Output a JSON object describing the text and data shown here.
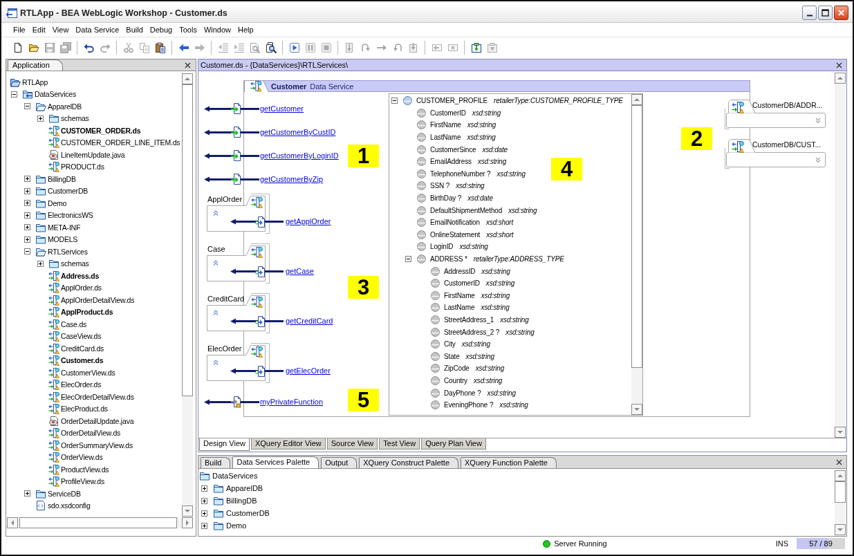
{
  "window": {
    "title": "RTLApp - BEA WebLogic Workshop - Customer.ds"
  },
  "menu": [
    "File",
    "Edit",
    "View",
    "Data Service",
    "Build",
    "Debug",
    "Tools",
    "Window",
    "Help"
  ],
  "toolbar": [
    [
      {
        "kind": "new",
        "disabled": false
      },
      {
        "kind": "open",
        "disabled": false
      },
      {
        "kind": "save",
        "disabled": true
      },
      {
        "kind": "saveall",
        "disabled": true
      }
    ],
    [
      {
        "kind": "undo",
        "disabled": false
      },
      {
        "kind": "redo",
        "disabled": true
      }
    ],
    [
      {
        "kind": "cut",
        "disabled": true
      },
      {
        "kind": "copy",
        "disabled": true
      },
      {
        "kind": "paste",
        "disabled": false
      }
    ],
    [
      {
        "kind": "back",
        "disabled": false
      },
      {
        "kind": "forward",
        "disabled": true
      }
    ],
    [
      {
        "kind": "outdent",
        "disabled": true
      },
      {
        "kind": "indent",
        "disabled": true
      },
      {
        "kind": "find",
        "disabled": true
      },
      {
        "kind": "findfiles",
        "disabled": false
      }
    ],
    [
      {
        "kind": "run",
        "disabled": false
      },
      {
        "kind": "pause",
        "disabled": true
      },
      {
        "kind": "stop",
        "disabled": true
      }
    ],
    [
      {
        "kind": "stepinto",
        "disabled": true
      },
      {
        "kind": "stepover",
        "disabled": true
      },
      {
        "kind": "stepnext",
        "disabled": true
      },
      {
        "kind": "stepout",
        "disabled": true
      },
      {
        "kind": "runto",
        "disabled": true
      }
    ],
    [
      {
        "kind": "collapse",
        "disabled": true
      },
      {
        "kind": "expand",
        "disabled": true
      }
    ],
    [
      {
        "kind": "import",
        "disabled": false
      },
      {
        "kind": "remove",
        "disabled": true
      }
    ]
  ],
  "app_panel": {
    "tab": "Application",
    "tree": [
      {
        "label": "RTLApp",
        "kind": "project",
        "children": [
          {
            "label": "DataServices",
            "kind": "services",
            "expanded": true,
            "children": [
              {
                "label": "ApparelDB",
                "kind": "folder",
                "expanded": true,
                "children": [
                  {
                    "label": "schemas",
                    "kind": "folder",
                    "expanded": false
                  },
                  {
                    "label": "CUSTOMER_ORDER.ds",
                    "kind": "ds",
                    "bold": true
                  },
                  {
                    "label": "CUSTOMER_ORDER_LINE_ITEM.ds",
                    "kind": "ds",
                    "bold": false
                  },
                  {
                    "label": "LineItemUpdate.java",
                    "kind": "java",
                    "bold": false
                  },
                  {
                    "label": "PRODUCT.ds",
                    "kind": "ds",
                    "bold": false
                  }
                ]
              },
              {
                "label": "BillingDB",
                "kind": "folder",
                "expanded": false
              },
              {
                "label": "CustomerDB",
                "kind": "folder",
                "expanded": false
              },
              {
                "label": "Demo",
                "kind": "folder",
                "expanded": false
              },
              {
                "label": "ElectronicsWS",
                "kind": "folder",
                "expanded": false
              },
              {
                "label": "META-INF",
                "kind": "folder",
                "expanded": false
              },
              {
                "label": "MODELS",
                "kind": "folder",
                "expanded": false
              },
              {
                "label": "RTLServices",
                "kind": "folder",
                "expanded": true,
                "children": [
                  {
                    "label": "schemas",
                    "kind": "folder",
                    "expanded": false
                  },
                  {
                    "label": "Address.ds",
                    "kind": "ds",
                    "bold": true
                  },
                  {
                    "label": "ApplOrder.ds",
                    "kind": "ds",
                    "bold": false
                  },
                  {
                    "label": "ApplOrderDetailView.ds",
                    "kind": "ds",
                    "bold": false
                  },
                  {
                    "label": "ApplProduct.ds",
                    "kind": "ds",
                    "bold": true
                  },
                  {
                    "label": "Case.ds",
                    "kind": "ds",
                    "bold": false
                  },
                  {
                    "label": "CaseView.ds",
                    "kind": "ds",
                    "bold": false
                  },
                  {
                    "label": "CreditCard.ds",
                    "kind": "ds",
                    "bold": false
                  },
                  {
                    "label": "Customer.ds",
                    "kind": "ds",
                    "bold": true
                  },
                  {
                    "label": "CustomerView.ds",
                    "kind": "ds",
                    "bold": false
                  },
                  {
                    "label": "ElecOrder.ds",
                    "kind": "ds",
                    "bold": false
                  },
                  {
                    "label": "ElecOrderDetailView.ds",
                    "kind": "ds",
                    "bold": false
                  },
                  {
                    "label": "ElecProduct.ds",
                    "kind": "ds",
                    "bold": false
                  },
                  {
                    "label": "OrderDetailUpdate.java",
                    "kind": "java",
                    "bold": false
                  },
                  {
                    "label": "OrderDetailView.ds",
                    "kind": "ds",
                    "bold": false
                  },
                  {
                    "label": "OrderSummaryView.ds",
                    "kind": "ds",
                    "bold": false
                  },
                  {
                    "label": "OrderView.ds",
                    "kind": "ds",
                    "bold": false
                  },
                  {
                    "label": "ProductView.ds",
                    "kind": "ds",
                    "bold": false
                  },
                  {
                    "label": "ProfileView.ds",
                    "kind": "ds",
                    "bold": false
                  }
                ]
              },
              {
                "label": "ServiceDB",
                "kind": "folder",
                "expanded": false
              },
              {
                "label": "sdo.xsdconfig",
                "kind": "config",
                "bold": false
              }
            ]
          }
        ]
      }
    ]
  },
  "editor": {
    "title": "Customer.ds - {DataServices}\\RTLServices\\",
    "data_service": {
      "name": "Customer",
      "label": "Data Service",
      "functions": {
        "callout": "1",
        "items": [
          {
            "name": "getCustomer"
          },
          {
            "name": "getCustomerByCustID"
          },
          {
            "name": "getCustomerByLoginID"
          },
          {
            "name": "getCustomerByZip"
          }
        ]
      },
      "relationships": {
        "callout": "3",
        "items": [
          {
            "label": "ApplOrder",
            "function": "getApplOrder"
          },
          {
            "label": "Case",
            "function": "getCase"
          },
          {
            "label": "CreditCard",
            "function": "getCreditCard"
          },
          {
            "label": "ElecOrder",
            "function": "getElecOrder"
          }
        ]
      },
      "private_functions": {
        "callout": "5",
        "items": [
          {
            "name": "myPrivateFunction"
          }
        ]
      },
      "schema": {
        "callout": "4",
        "tree": [
          {
            "name": "CUSTOMER_PROFILE",
            "type": "retailerType:CUSTOMER_PROFILE_TYPE",
            "expanded": true,
            "children": [
              {
                "name": "CustomerID",
                "type": "xsd:string"
              },
              {
                "name": "FirstName",
                "type": "xsd:string"
              },
              {
                "name": "LastName",
                "type": "xsd:string"
              },
              {
                "name": "CustomerSince",
                "type": "xsd:date"
              },
              {
                "name": "EmailAddress",
                "type": "xsd:string"
              },
              {
                "name": "TelephoneNumber ?",
                "type": "xsd:string"
              },
              {
                "name": "SSN ?",
                "type": "xsd:string"
              },
              {
                "name": "BirthDay ?",
                "type": "xsd:date"
              },
              {
                "name": "DefaultShipmentMethod",
                "type": "xsd:string"
              },
              {
                "name": "EmailNotification",
                "type": "xsd:short"
              },
              {
                "name": "OnlineStatement",
                "type": "xsd:short"
              },
              {
                "name": "LoginID",
                "type": "xsd:string"
              },
              {
                "name": "ADDRESS *",
                "type": "retailerType:ADDRESS_TYPE",
                "expanded": true,
                "children": [
                  {
                    "name": "AddressID",
                    "type": "xsd:string"
                  },
                  {
                    "name": "CustomerID",
                    "type": "xsd:string"
                  },
                  {
                    "name": "FirstName",
                    "type": "xsd:string"
                  },
                  {
                    "name": "LastName",
                    "type": "xsd:string"
                  },
                  {
                    "name": "StreetAddress_1",
                    "type": "xsd:string"
                  },
                  {
                    "name": "StreetAddress_2 ?",
                    "type": "xsd:string"
                  },
                  {
                    "name": "City",
                    "type": "xsd:string"
                  },
                  {
                    "name": "State",
                    "type": "xsd:string"
                  },
                  {
                    "name": "ZipCode",
                    "type": "xsd:string"
                  },
                  {
                    "name": "Country",
                    "type": "xsd:string"
                  },
                  {
                    "name": "DayPhone ?",
                    "type": "xsd:string"
                  },
                  {
                    "name": "EveningPhone ?",
                    "type": "xsd:string"
                  }
                ]
              }
            ]
          }
        ]
      },
      "data_sources": {
        "callout": "2",
        "items": [
          {
            "label": "CustomerDB/ADDR..."
          },
          {
            "label": "CustomerDB/CUST..."
          }
        ]
      }
    },
    "view_tabs": [
      {
        "label": "Design View",
        "selected": true
      },
      {
        "label": "XQuery Editor View",
        "selected": false
      },
      {
        "label": "Source View",
        "selected": false
      },
      {
        "label": "Test View",
        "selected": false
      },
      {
        "label": "Query Plan View",
        "selected": false
      }
    ]
  },
  "palette": {
    "tabs": [
      {
        "label": "Build",
        "selected": false
      },
      {
        "label": "Data Services Palette",
        "selected": true
      },
      {
        "label": "Output",
        "selected": false
      },
      {
        "label": "XQuery Construct Palette",
        "selected": false
      },
      {
        "label": "XQuery Function Palette",
        "selected": false
      }
    ],
    "tree": [
      {
        "label": "DataServices",
        "kind": "folder",
        "children": [
          {
            "label": "ApparelDB",
            "kind": "folder",
            "expanded": false
          },
          {
            "label": "BillingDB",
            "kind": "folder",
            "expanded": false
          },
          {
            "label": "CustomerDB",
            "kind": "folder",
            "expanded": false
          },
          {
            "label": "Demo",
            "kind": "folder",
            "expanded": false
          }
        ]
      }
    ]
  },
  "status_bar": {
    "server": "Server Running",
    "mode": "INS",
    "memory": {
      "reading": "57 / 89",
      "level": 0.66
    }
  }
}
